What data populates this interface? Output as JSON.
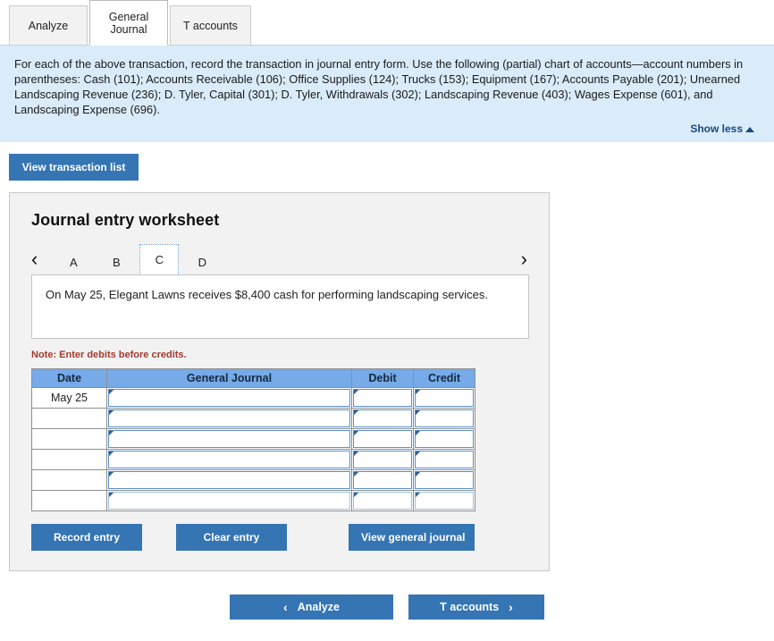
{
  "tabs": [
    {
      "label": "Analyze",
      "active": false
    },
    {
      "label": "General\nJournal",
      "active": true
    },
    {
      "label": "T accounts",
      "active": false
    }
  ],
  "banner": {
    "text": "For each of the above transaction, record the transaction in journal entry form. Use the following (partial) chart of accounts—account numbers in parentheses: Cash (101); Accounts Receivable (106); Office Supplies (124); Trucks (153); Equipment (167); Accounts Payable (201); Unearned Landscaping Revenue (236); D. Tyler, Capital (301); D. Tyler, Withdrawals (302); Landscaping Revenue (403); Wages Expense (601), and Landscaping Expense (696).",
    "show_less_label": "Show less",
    "background_color": "#daebfa"
  },
  "view_transaction_list_label": "View transaction list",
  "worksheet": {
    "title": "Journal entry worksheet",
    "prev_arrow": "‹",
    "next_arrow": "›",
    "pages": [
      {
        "label": "A",
        "active": false
      },
      {
        "label": "B",
        "active": false
      },
      {
        "label": "C",
        "active": true
      },
      {
        "label": "D",
        "active": false
      }
    ],
    "transaction_text": "On May 25, Elegant Lawns receives $8,400 cash for performing landscaping services.",
    "note": "Note: Enter debits before credits.",
    "table": {
      "headers": [
        "Date",
        "General Journal",
        "Debit",
        "Credit"
      ],
      "rows": [
        {
          "date": "May 25",
          "general_journal": "",
          "debit": "",
          "credit": ""
        },
        {
          "date": "",
          "general_journal": "",
          "debit": "",
          "credit": ""
        },
        {
          "date": "",
          "general_journal": "",
          "debit": "",
          "credit": ""
        },
        {
          "date": "",
          "general_journal": "",
          "debit": "",
          "credit": ""
        },
        {
          "date": "",
          "general_journal": "",
          "debit": "",
          "credit": ""
        },
        {
          "date": "",
          "general_journal": "",
          "debit": "",
          "credit": ""
        }
      ]
    },
    "actions": {
      "record_entry": "Record entry",
      "clear_entry": "Clear entry",
      "view_general_journal": "View general journal"
    }
  },
  "bottom_nav": {
    "prev_label": "Analyze",
    "prev_chevron": "‹",
    "next_label": "T accounts",
    "next_chevron": "›"
  },
  "colors": {
    "button_blue": "#3575b4",
    "table_header_blue": "#76aae8",
    "banner_blue": "#daebfa",
    "note_red": "#a33a2c",
    "link_blue": "#18497e"
  }
}
